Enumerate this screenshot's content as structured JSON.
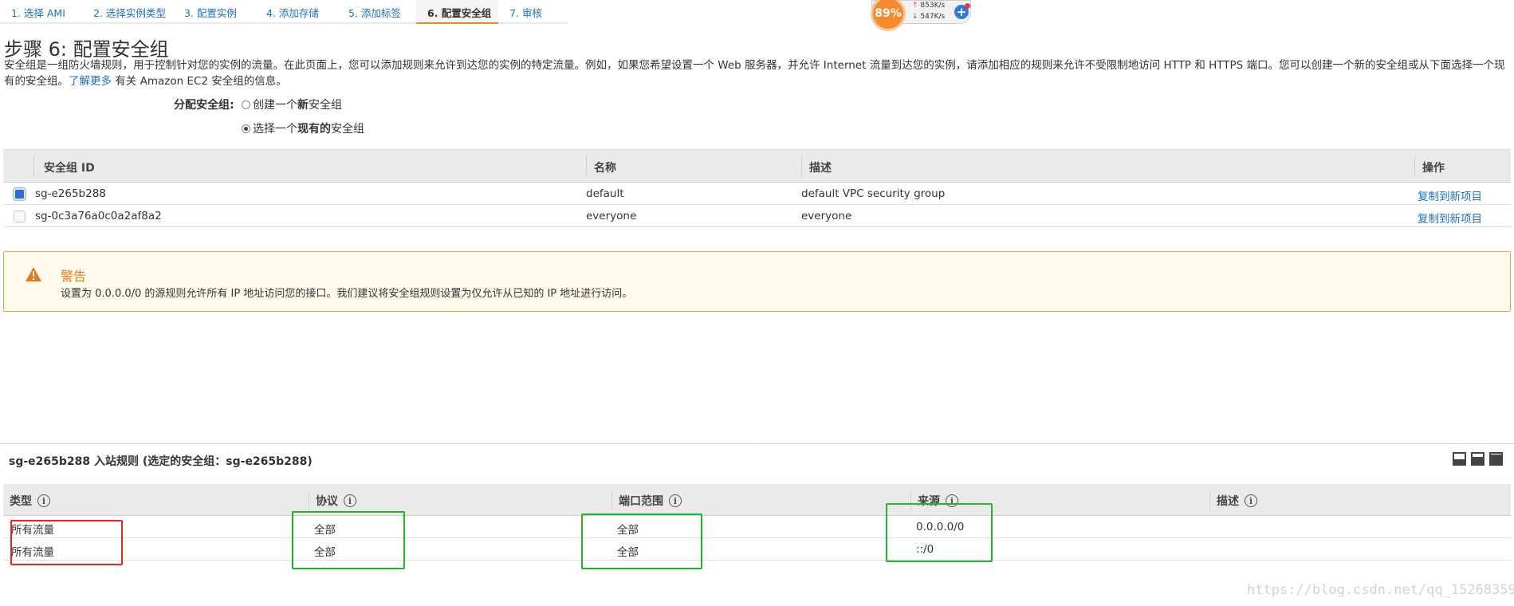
{
  "wizard": {
    "steps": [
      {
        "label": "1. 选择 AMI"
      },
      {
        "label": "2. 选择实例类型"
      },
      {
        "label": "3. 配置实例"
      },
      {
        "label": "4. 添加存储"
      },
      {
        "label": "5. 添加标签"
      },
      {
        "label": "6. 配置安全组",
        "active": true
      },
      {
        "label": "7. 审核"
      }
    ]
  },
  "speed_widget": {
    "cpu": "89%",
    "upload": "853K/s",
    "download": "547K/s"
  },
  "page": {
    "title": "步骤 6: 配置安全组",
    "intro_text": "安全组是一组防火墙规则，用于控制针对您的实例的流量。在此页面上，您可以添加规则来允许到达您的实例的特定流量。例如，如果您希望设置一个 Web 服务器，并允许 Internet 流量到达您的实例，请添加相应的规则来允许不受限制地访问 HTTP 和 HTTPS 端口。您可以创建一个新的安全组或从下面选择一个现有的安全组。",
    "learn_more": "了解更多",
    "learn_more_suffix": " 有关 Amazon EC2 安全组的信息。"
  },
  "assign": {
    "label": "分配安全组:",
    "option_new_pre": "创建一个",
    "option_new_bold": "新",
    "option_new_post": "安全组",
    "option_existing_pre": "选择一个",
    "option_existing_bold": "现有的",
    "option_existing_post": "安全组"
  },
  "sg_table": {
    "headers": {
      "id": "安全组 ID",
      "name": "名称",
      "description": "描述",
      "actions": "操作"
    },
    "rows": [
      {
        "checked": true,
        "id": "sg-e265b288",
        "name": "default",
        "description": "default VPC security group",
        "action": "复制到新项目"
      },
      {
        "checked": false,
        "id": "sg-0c3a76a0c0a2af8a2",
        "name": "everyone",
        "description": "everyone",
        "action": "复制到新项目"
      }
    ]
  },
  "warning": {
    "title": "警告",
    "text": "设置为 0.0.0.0/0 的源规则允许所有 IP 地址访问您的接口。我们建议将安全组规则设置为仅允许从已知的 IP 地址进行访问。"
  },
  "rules_panel": {
    "title": "sg-e265b288 入站规则 (选定的安全组：sg-e265b288)",
    "headers": {
      "type": "类型",
      "protocol": "协议",
      "port_range": "端口范围",
      "source": "来源",
      "description": "描述"
    },
    "rows": [
      {
        "type": "所有流量",
        "protocol": "全部",
        "port_range": "全部",
        "source": "0.0.0.0/0",
        "description": ""
      },
      {
        "type": "所有流量",
        "protocol": "全部",
        "port_range": "全部",
        "source": "::/0",
        "description": ""
      }
    ]
  },
  "watermark": "https://blog.csdn.net/qq_15268359",
  "colors": {
    "link": "#2070b8",
    "active_step_underline": "#e88a1f",
    "warning_border": "#e8a14b",
    "warning_title": "#e07c1e",
    "highlight_red": "#e8231e",
    "highlight_green": "#1fb524",
    "checkbox_selected": "#2b6fd6"
  },
  "icons": {
    "warning": "warning-triangle-icon",
    "info": "info-icon"
  }
}
